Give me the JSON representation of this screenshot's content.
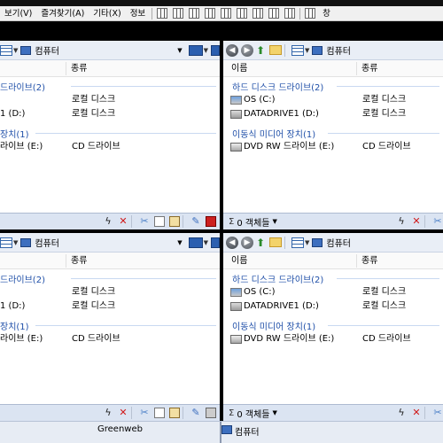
{
  "menu": {
    "items": [
      "보기(V)",
      "즐겨찾기(A)",
      "기타(X)",
      "정보"
    ],
    "right_item": "창"
  },
  "panes": {
    "top_left": {
      "address": "컴퓨터",
      "columns": {
        "name": "",
        "type": "종류"
      },
      "groups": {
        "hdd": "드라이브(2)",
        "removable": "장치(1)"
      },
      "rows": [
        {
          "name": "",
          "type": "로컬 디스크"
        },
        {
          "name": "1 (D:)",
          "type": "로컬 디스크"
        },
        {
          "name": "라이브 (E:)",
          "type": "CD 드라이브"
        }
      ]
    },
    "top_right": {
      "address": "컴퓨터",
      "columns": {
        "name": "이름",
        "type": "종류"
      },
      "groups": {
        "hdd": "하드 디스크 드라이브(2)",
        "removable": "이동식 미디어 장치(1)"
      },
      "rows": [
        {
          "name": "OS (C:)",
          "type": "로컬 디스크"
        },
        {
          "name": "DATADRIVE1 (D:)",
          "type": "로컬 디스크"
        },
        {
          "name": "DVD RW 드라이브 (E:)",
          "type": "CD 드라이브"
        }
      ],
      "status": {
        "sigma": "Σ",
        "count": "0 객체들"
      }
    },
    "bottom_left": {
      "address": "컴퓨터",
      "columns": {
        "name": "",
        "type": "종류"
      },
      "groups": {
        "hdd": "드라이브(2)",
        "removable": "장치(1)"
      },
      "rows": [
        {
          "name": "",
          "type": "로컬 디스크"
        },
        {
          "name": "1 (D:)",
          "type": "로컬 디스크"
        },
        {
          "name": "라이브 (E:)",
          "type": "CD 드라이브"
        }
      ]
    },
    "bottom_right": {
      "address": "컴퓨터",
      "columns": {
        "name": "이름",
        "type": "종류"
      },
      "groups": {
        "hdd": "하드 디스크 드라이브(2)",
        "removable": "이동식 미디어 장치(1)"
      },
      "rows": [
        {
          "name": "OS (C:)",
          "type": "로컬 디스크"
        },
        {
          "name": "DATADRIVE1 (D:)",
          "type": "로컬 디스크"
        },
        {
          "name": "DVD RW 드라이브 (E:)",
          "type": "CD 드라이브"
        }
      ],
      "status": {
        "sigma": "Σ",
        "count": "0 객체들"
      }
    }
  },
  "bottom": {
    "left_label": "Greenweb",
    "right_label": "컴퓨터"
  },
  "icons": {
    "back": "back-arrow-icon",
    "forward": "forward-arrow-icon",
    "up": "up-folder-icon",
    "view": "view-mode-icon",
    "computer": "computer-icon",
    "bolt": "bolt-icon",
    "delete": "delete-x-icon",
    "cut": "scissors-icon",
    "copy": "copy-icon",
    "paste": "paste-icon",
    "brush": "brush-icon"
  },
  "colors": {
    "group_text": "#1f4fa8",
    "status_bg": "#dbe4f2",
    "delete": "#d01818"
  }
}
